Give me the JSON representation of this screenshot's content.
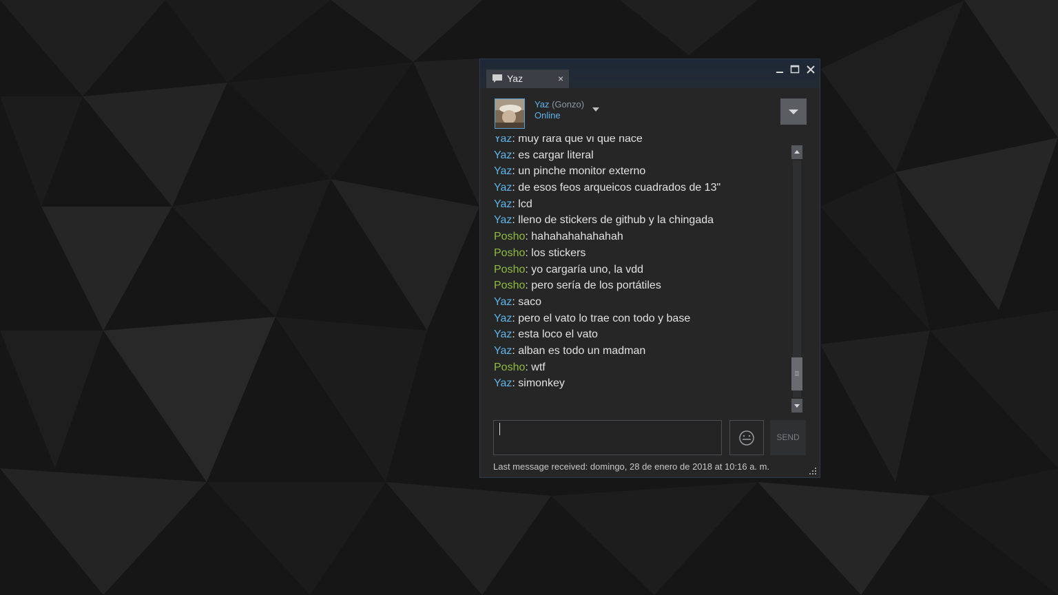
{
  "colors": {
    "yaz": "#5fb4ea",
    "posho": "#8fbc3f"
  },
  "tab": {
    "label": "Yaz",
    "close": "×",
    "icon": "chat-bubble-icon"
  },
  "friend": {
    "name": "Yaz",
    "nickname": "(Gonzo)",
    "status": "Online"
  },
  "messages": [
    {
      "sender": "Yaz",
      "text": "muy rara que vi que hace",
      "color": "#5fb4ea"
    },
    {
      "sender": "Yaz",
      "text": "es cargar literal",
      "color": "#5fb4ea"
    },
    {
      "sender": "Yaz",
      "text": "un pinche monitor externo",
      "color": "#5fb4ea"
    },
    {
      "sender": "Yaz",
      "text": "de esos feos arqueicos cuadrados de 13\"",
      "color": "#5fb4ea"
    },
    {
      "sender": "Yaz",
      "text": "lcd",
      "color": "#5fb4ea"
    },
    {
      "sender": "Yaz",
      "text": "lleno de stickers de github y la chingada",
      "color": "#5fb4ea"
    },
    {
      "sender": "Posho",
      "text": "hahahahahahahah",
      "color": "#8fbc3f"
    },
    {
      "sender": "Posho",
      "text": "los stickers",
      "color": "#8fbc3f"
    },
    {
      "sender": "Posho",
      "text": "yo cargaría uno, la vdd",
      "color": "#8fbc3f"
    },
    {
      "sender": "Posho",
      "text": "pero sería de los portátiles",
      "color": "#8fbc3f"
    },
    {
      "sender": "Yaz",
      "text": "saco",
      "color": "#5fb4ea"
    },
    {
      "sender": "Yaz",
      "text": "pero el vato lo trae con todo y base",
      "color": "#5fb4ea"
    },
    {
      "sender": "Yaz",
      "text": "esta loco el vato",
      "color": "#5fb4ea"
    },
    {
      "sender": "Yaz",
      "text": "alban es todo un madman",
      "color": "#5fb4ea"
    },
    {
      "sender": "Posho",
      "text": "wtf",
      "color": "#8fbc3f"
    },
    {
      "sender": "Yaz",
      "text": "simonkey",
      "color": "#5fb4ea"
    }
  ],
  "composer": {
    "value": "",
    "send_label": "SEND"
  },
  "footer": {
    "last_message": "Last message received: domingo, 28 de enero de 2018 at 10:16 a. m."
  }
}
